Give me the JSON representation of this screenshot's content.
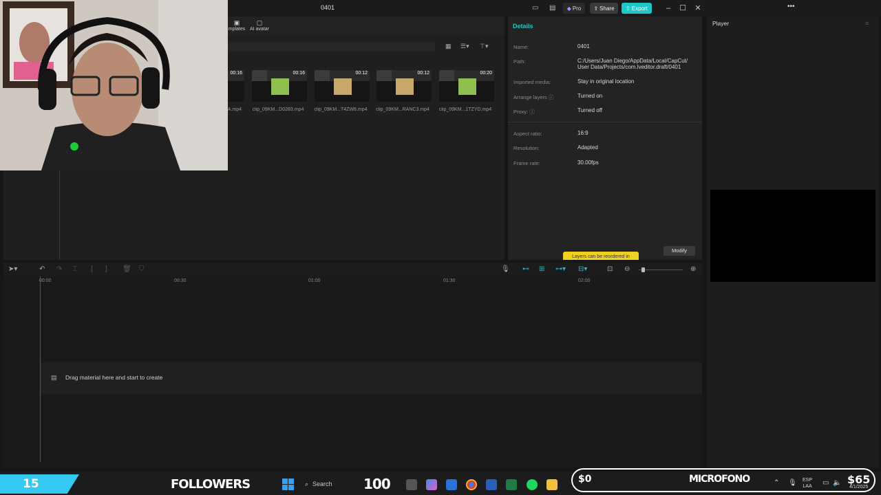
{
  "titlebar": {
    "title": "0401",
    "pro_label": "Pro",
    "share_label": "Share",
    "export_label": "Export",
    "more_label": "•••"
  },
  "media": {
    "tabs": [
      {
        "label": "mplates",
        "icon": "template-icon"
      },
      {
        "label": "AI avatar",
        "icon": "avatar-icon"
      }
    ],
    "clips": [
      {
        "name": "A.mp4",
        "duration": "00:16"
      },
      {
        "name": "clip_09KM...D0283.mp4",
        "duration": "00:16"
      },
      {
        "name": "clip_09KM...T4ZW8.mp4",
        "duration": "00:12"
      },
      {
        "name": "clip_09KM...RANC3.mp4",
        "duration": "00:12"
      },
      {
        "name": "clip_09KM...1TZYD.mp4",
        "duration": "00:20"
      }
    ]
  },
  "details": {
    "title": "Details",
    "rows": [
      {
        "label": "Name:",
        "value": "0401"
      },
      {
        "label": "Path:",
        "value": "C:/Users/Juan Diego/AppData/Local/CapCut/"
      },
      {
        "label": "",
        "value": "User Data/Projects/com.lveditor.draft/0401"
      },
      {
        "label": "Imported media:",
        "value": "Stay in original location"
      },
      {
        "label": "Arrange layers ⓘ",
        "value": "Turned on"
      },
      {
        "label": "Proxy: ⓘ",
        "value": "Turned off"
      },
      {
        "label": "Aspect ratio:",
        "value": "16:9"
      },
      {
        "label": "Resolution:",
        "value": "Adapted"
      },
      {
        "label": "Frame rate:",
        "value": "30.00fps"
      }
    ],
    "modify_label": "Modify",
    "tooltip": "Layers can be reordered in"
  },
  "player": {
    "title": "Player"
  },
  "timeline": {
    "ticks": [
      "00:00",
      "00:30",
      "01:00",
      "01:30",
      "02:00"
    ],
    "drag_hint": "Drag material here and start to create"
  },
  "overlay": {
    "followers_count": "15",
    "followers_label": "FOLLOWERS",
    "goal": "100",
    "money_left": "$0",
    "mic_label": "MICROFONO",
    "money_right": "$65"
  },
  "taskbar": {
    "search_placeholder": "Search",
    "lang_line1": "ESP",
    "lang_line2": "LAA",
    "date": "4/1/2025"
  },
  "colors": {
    "accent": "#1fc7c7",
    "followers_bg": "#35c8f0",
    "tooltip_bg": "#f0d020"
  }
}
